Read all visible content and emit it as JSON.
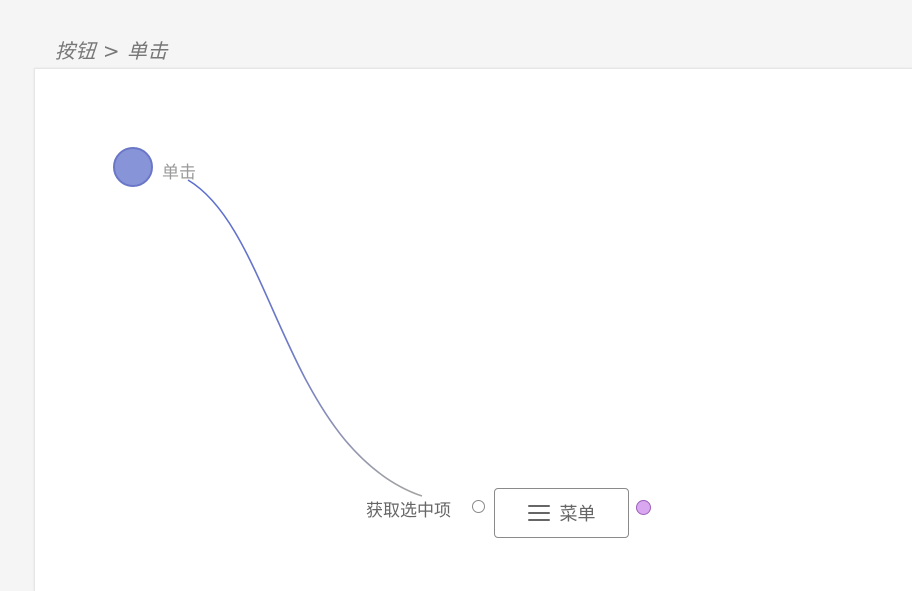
{
  "breadcrumb": "按钮 > 单击",
  "event_node": {
    "label": "单击",
    "color": "#8894d8"
  },
  "menu_node": {
    "icon": "menu-icon",
    "label": "菜单",
    "input_port_label": "获取选中项",
    "output_port_color": "#d9a6f0"
  },
  "connection": {
    "from": "单击",
    "to": "获取选中项"
  }
}
